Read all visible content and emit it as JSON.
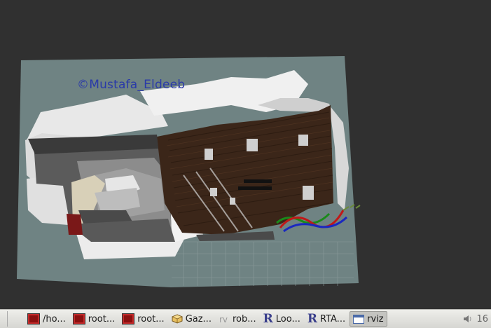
{
  "viewport": {
    "watermark": "©Mustafa_Eldeeb"
  },
  "taskbar": {
    "items": [
      {
        "label": "/ho...",
        "icon": "terminal-icon",
        "active": false
      },
      {
        "label": "root...",
        "icon": "terminal-icon",
        "active": false
      },
      {
        "label": "root...",
        "icon": "terminal-icon",
        "active": false
      },
      {
        "label": "Gaz...",
        "icon": "gazebo-icon",
        "active": false
      },
      {
        "label": "rob...",
        "icon": "rviz-r-icon",
        "active": false
      },
      {
        "label": "Loo...",
        "icon": "r-icon",
        "active": false
      },
      {
        "label": "RTA...",
        "icon": "r-icon",
        "active": false
      },
      {
        "label": "rviz",
        "icon": "rviz-window-icon",
        "active": true
      }
    ],
    "tray_text": "16",
    "tray_icon": "speaker-icon"
  },
  "colors": {
    "background": "#303030",
    "map_floor": "#6f8282",
    "wood": "#3a2418",
    "taskbar": "#e2e2de"
  }
}
